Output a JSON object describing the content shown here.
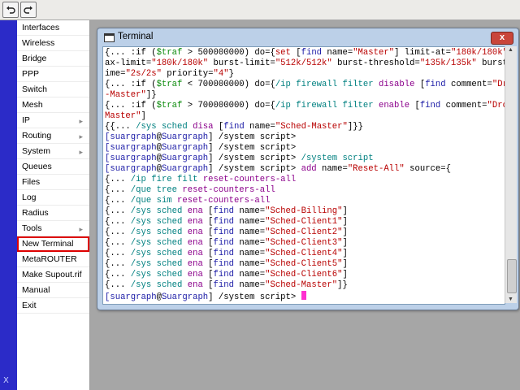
{
  "toolbar": {
    "undo_icon": "undo-icon",
    "redo_icon": "redo-icon"
  },
  "strip": {
    "label": "X"
  },
  "sidebar": {
    "items": [
      {
        "label": "Interfaces",
        "arrow": false
      },
      {
        "label": "Wireless",
        "arrow": false
      },
      {
        "label": "Bridge",
        "arrow": false
      },
      {
        "label": "PPP",
        "arrow": false
      },
      {
        "label": "Switch",
        "arrow": false
      },
      {
        "label": "Mesh",
        "arrow": false
      },
      {
        "label": "IP",
        "arrow": true
      },
      {
        "label": "Routing",
        "arrow": true
      },
      {
        "label": "System",
        "arrow": true
      },
      {
        "label": "Queues",
        "arrow": false
      },
      {
        "label": "Files",
        "arrow": false
      },
      {
        "label": "Log",
        "arrow": false
      },
      {
        "label": "Radius",
        "arrow": false
      },
      {
        "label": "Tools",
        "arrow": true
      },
      {
        "label": "New Terminal",
        "arrow": false,
        "selected": true
      },
      {
        "label": "MetaROUTER",
        "arrow": false
      },
      {
        "label": "Make Supout.rif",
        "arrow": false
      },
      {
        "label": "Manual",
        "arrow": false
      },
      {
        "label": "Exit",
        "arrow": false
      }
    ]
  },
  "window": {
    "title": "Terminal",
    "close_label": "x"
  },
  "terminal": {
    "lines": [
      [
        [
          "{... :if (",
          "blk"
        ],
        [
          "$traf",
          "grn"
        ],
        [
          " > 500000000) do={",
          "blk"
        ],
        [
          "set",
          "red"
        ],
        [
          " [",
          "blk"
        ],
        [
          "find",
          "blu"
        ],
        [
          " name=",
          "blk"
        ],
        [
          "\"Master\"",
          "red"
        ],
        [
          "] limit-at=",
          "blk"
        ],
        [
          "\"180k/180k\"",
          "red"
        ],
        [
          " m",
          "blk"
        ]
      ],
      [
        [
          "ax-limit=",
          "blk"
        ],
        [
          "\"180k/180k\"",
          "red"
        ],
        [
          " burst-limit=",
          "blk"
        ],
        [
          "\"512k/512k\"",
          "red"
        ],
        [
          " burst-threshold=",
          "blk"
        ],
        [
          "\"135k/135k\"",
          "red"
        ],
        [
          " burst-t",
          "blk"
        ]
      ],
      [
        [
          "ime=",
          "blk"
        ],
        [
          "\"2s/2s\"",
          "red"
        ],
        [
          " priority=",
          "blk"
        ],
        [
          "\"4\"",
          "red"
        ],
        [
          "}",
          "blk"
        ]
      ],
      [
        [
          "{... :if (",
          "blk"
        ],
        [
          "$traf",
          "grn"
        ],
        [
          " < 700000000) do={",
          "blk"
        ],
        [
          "/ip firewall filter",
          "teal"
        ],
        [
          " ",
          "blk"
        ],
        [
          "disable",
          "pur"
        ],
        [
          " [",
          "blk"
        ],
        [
          "find",
          "blu"
        ],
        [
          " comment=",
          "blk"
        ],
        [
          "\"Drop",
          "red"
        ]
      ],
      [
        [
          "-Master\"",
          "red"
        ],
        [
          "]}",
          "blk"
        ]
      ],
      [
        [
          "{... :if (",
          "blk"
        ],
        [
          "$traf",
          "grn"
        ],
        [
          " > 700000000) do={",
          "blk"
        ],
        [
          "/ip firewall filter",
          "teal"
        ],
        [
          " ",
          "blk"
        ],
        [
          "enable",
          "pur"
        ],
        [
          " [",
          "blk"
        ],
        [
          "find",
          "blu"
        ],
        [
          " comment=",
          "blk"
        ],
        [
          "\"Drop-",
          "red"
        ]
      ],
      [
        [
          "Master\"",
          "red"
        ],
        [
          "]",
          "blk"
        ]
      ],
      [
        [
          "{{... ",
          "blk"
        ],
        [
          "/sys sched",
          "teal"
        ],
        [
          " ",
          "blk"
        ],
        [
          "disa",
          "pur"
        ],
        [
          " [",
          "blk"
        ],
        [
          "find",
          "blu"
        ],
        [
          " name=",
          "blk"
        ],
        [
          "\"Sched-Master\"",
          "red"
        ],
        [
          "]}}",
          "blk"
        ]
      ],
      [
        [
          "[suargraph",
          "blu"
        ],
        [
          "@",
          "blk"
        ],
        [
          "Suargraph",
          "blu"
        ],
        [
          "] /system script>",
          "blk"
        ]
      ],
      [
        [
          "[suargraph",
          "blu"
        ],
        [
          "@",
          "blk"
        ],
        [
          "Suargraph",
          "blu"
        ],
        [
          "] /system script>",
          "blk"
        ]
      ],
      [
        [
          "[suargraph",
          "blu"
        ],
        [
          "@",
          "blk"
        ],
        [
          "Suargraph",
          "blu"
        ],
        [
          "] /system script> ",
          "blk"
        ],
        [
          "/system script",
          "teal"
        ]
      ],
      [
        [
          "[suargraph",
          "blu"
        ],
        [
          "@",
          "blk"
        ],
        [
          "Suargraph",
          "blu"
        ],
        [
          "] /system script> ",
          "blk"
        ],
        [
          "add",
          "pur"
        ],
        [
          " name=",
          "blk"
        ],
        [
          "\"Reset-All\"",
          "red"
        ],
        [
          " source={",
          "blk"
        ]
      ],
      [
        [
          "{... ",
          "blk"
        ],
        [
          "/ip fire filt",
          "teal"
        ],
        [
          " ",
          "blk"
        ],
        [
          "reset-counters-all",
          "pur"
        ]
      ],
      [
        [
          "{... ",
          "blk"
        ],
        [
          "/que tree",
          "teal"
        ],
        [
          " ",
          "blk"
        ],
        [
          "reset-counters-all",
          "pur"
        ]
      ],
      [
        [
          "{... ",
          "blk"
        ],
        [
          "/que sim",
          "teal"
        ],
        [
          " ",
          "blk"
        ],
        [
          "reset-counters-all",
          "pur"
        ]
      ],
      [
        [
          "{... ",
          "blk"
        ],
        [
          "/sys sched",
          "teal"
        ],
        [
          " ",
          "blk"
        ],
        [
          "ena",
          "pur"
        ],
        [
          " [",
          "blk"
        ],
        [
          "find",
          "blu"
        ],
        [
          " name=",
          "blk"
        ],
        [
          "\"Sched-Billing\"",
          "red"
        ],
        [
          "]",
          "blk"
        ]
      ],
      [
        [
          "{... ",
          "blk"
        ],
        [
          "/sys sched",
          "teal"
        ],
        [
          " ",
          "blk"
        ],
        [
          "ena",
          "pur"
        ],
        [
          " [",
          "blk"
        ],
        [
          "find",
          "blu"
        ],
        [
          " name=",
          "blk"
        ],
        [
          "\"Sched-Client1\"",
          "red"
        ],
        [
          "]",
          "blk"
        ]
      ],
      [
        [
          "{... ",
          "blk"
        ],
        [
          "/sys sched",
          "teal"
        ],
        [
          " ",
          "blk"
        ],
        [
          "ena",
          "pur"
        ],
        [
          " [",
          "blk"
        ],
        [
          "find",
          "blu"
        ],
        [
          " name=",
          "blk"
        ],
        [
          "\"Sched-Client2\"",
          "red"
        ],
        [
          "]",
          "blk"
        ]
      ],
      [
        [
          "{... ",
          "blk"
        ],
        [
          "/sys sched",
          "teal"
        ],
        [
          " ",
          "blk"
        ],
        [
          "ena",
          "pur"
        ],
        [
          " [",
          "blk"
        ],
        [
          "find",
          "blu"
        ],
        [
          " name=",
          "blk"
        ],
        [
          "\"Sched-Client3\"",
          "red"
        ],
        [
          "]",
          "blk"
        ]
      ],
      [
        [
          "{... ",
          "blk"
        ],
        [
          "/sys sched",
          "teal"
        ],
        [
          " ",
          "blk"
        ],
        [
          "ena",
          "pur"
        ],
        [
          " [",
          "blk"
        ],
        [
          "find",
          "blu"
        ],
        [
          " name=",
          "blk"
        ],
        [
          "\"Sched-Client4\"",
          "red"
        ],
        [
          "]",
          "blk"
        ]
      ],
      [
        [
          "{... ",
          "blk"
        ],
        [
          "/sys sched",
          "teal"
        ],
        [
          " ",
          "blk"
        ],
        [
          "ena",
          "pur"
        ],
        [
          " [",
          "blk"
        ],
        [
          "find",
          "blu"
        ],
        [
          " name=",
          "blk"
        ],
        [
          "\"Sched-Client5\"",
          "red"
        ],
        [
          "]",
          "blk"
        ]
      ],
      [
        [
          "{... ",
          "blk"
        ],
        [
          "/sys sched",
          "teal"
        ],
        [
          " ",
          "blk"
        ],
        [
          "ena",
          "pur"
        ],
        [
          " [",
          "blk"
        ],
        [
          "find",
          "blu"
        ],
        [
          " name=",
          "blk"
        ],
        [
          "\"Sched-Client6\"",
          "red"
        ],
        [
          "]",
          "blk"
        ]
      ],
      [
        [
          "{... ",
          "blk"
        ],
        [
          "/sys sched",
          "teal"
        ],
        [
          " ",
          "blk"
        ],
        [
          "ena",
          "pur"
        ],
        [
          " [",
          "blk"
        ],
        [
          "find",
          "blu"
        ],
        [
          " name=",
          "blk"
        ],
        [
          "\"Sched-Master\"",
          "red"
        ],
        [
          "]}",
          "blk"
        ]
      ],
      [
        [
          "[suargraph",
          "blu"
        ],
        [
          "@",
          "blk"
        ],
        [
          "Suargraph",
          "blu"
        ],
        [
          "] /system script> ",
          "blk"
        ]
      ]
    ],
    "cursor_color": "#ff2fd0"
  },
  "colors": {
    "strip": "#2b2bc8",
    "selected_outline": "#dd0000",
    "window_frame": "#bcd0e8",
    "close_button": "#c9453a"
  }
}
